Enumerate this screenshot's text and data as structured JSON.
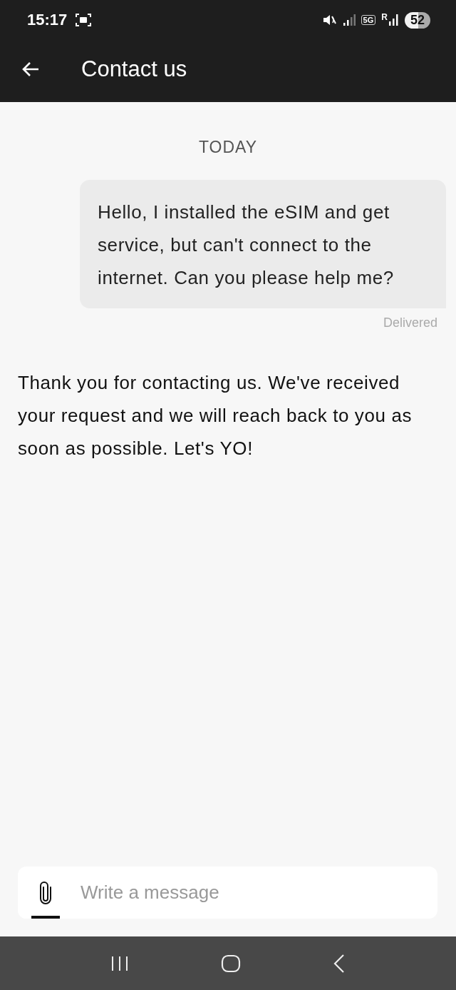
{
  "status_bar": {
    "time": "15:17",
    "network": "5G",
    "roaming": "R",
    "battery": "52"
  },
  "app_bar": {
    "title": "Contact us"
  },
  "chat": {
    "date_divider": "TODAY",
    "messages": [
      {
        "kind": "sent",
        "text": "Hello, I installed the eSIM and get service, but can't connect to the internet. Can you please help me?",
        "status": "Delivered"
      },
      {
        "kind": "received",
        "text": "Thank you for contacting us. We've received your request and we will reach back to you as soon as possible. Let's YO!"
      }
    ]
  },
  "composer": {
    "placeholder": "Write a message"
  }
}
